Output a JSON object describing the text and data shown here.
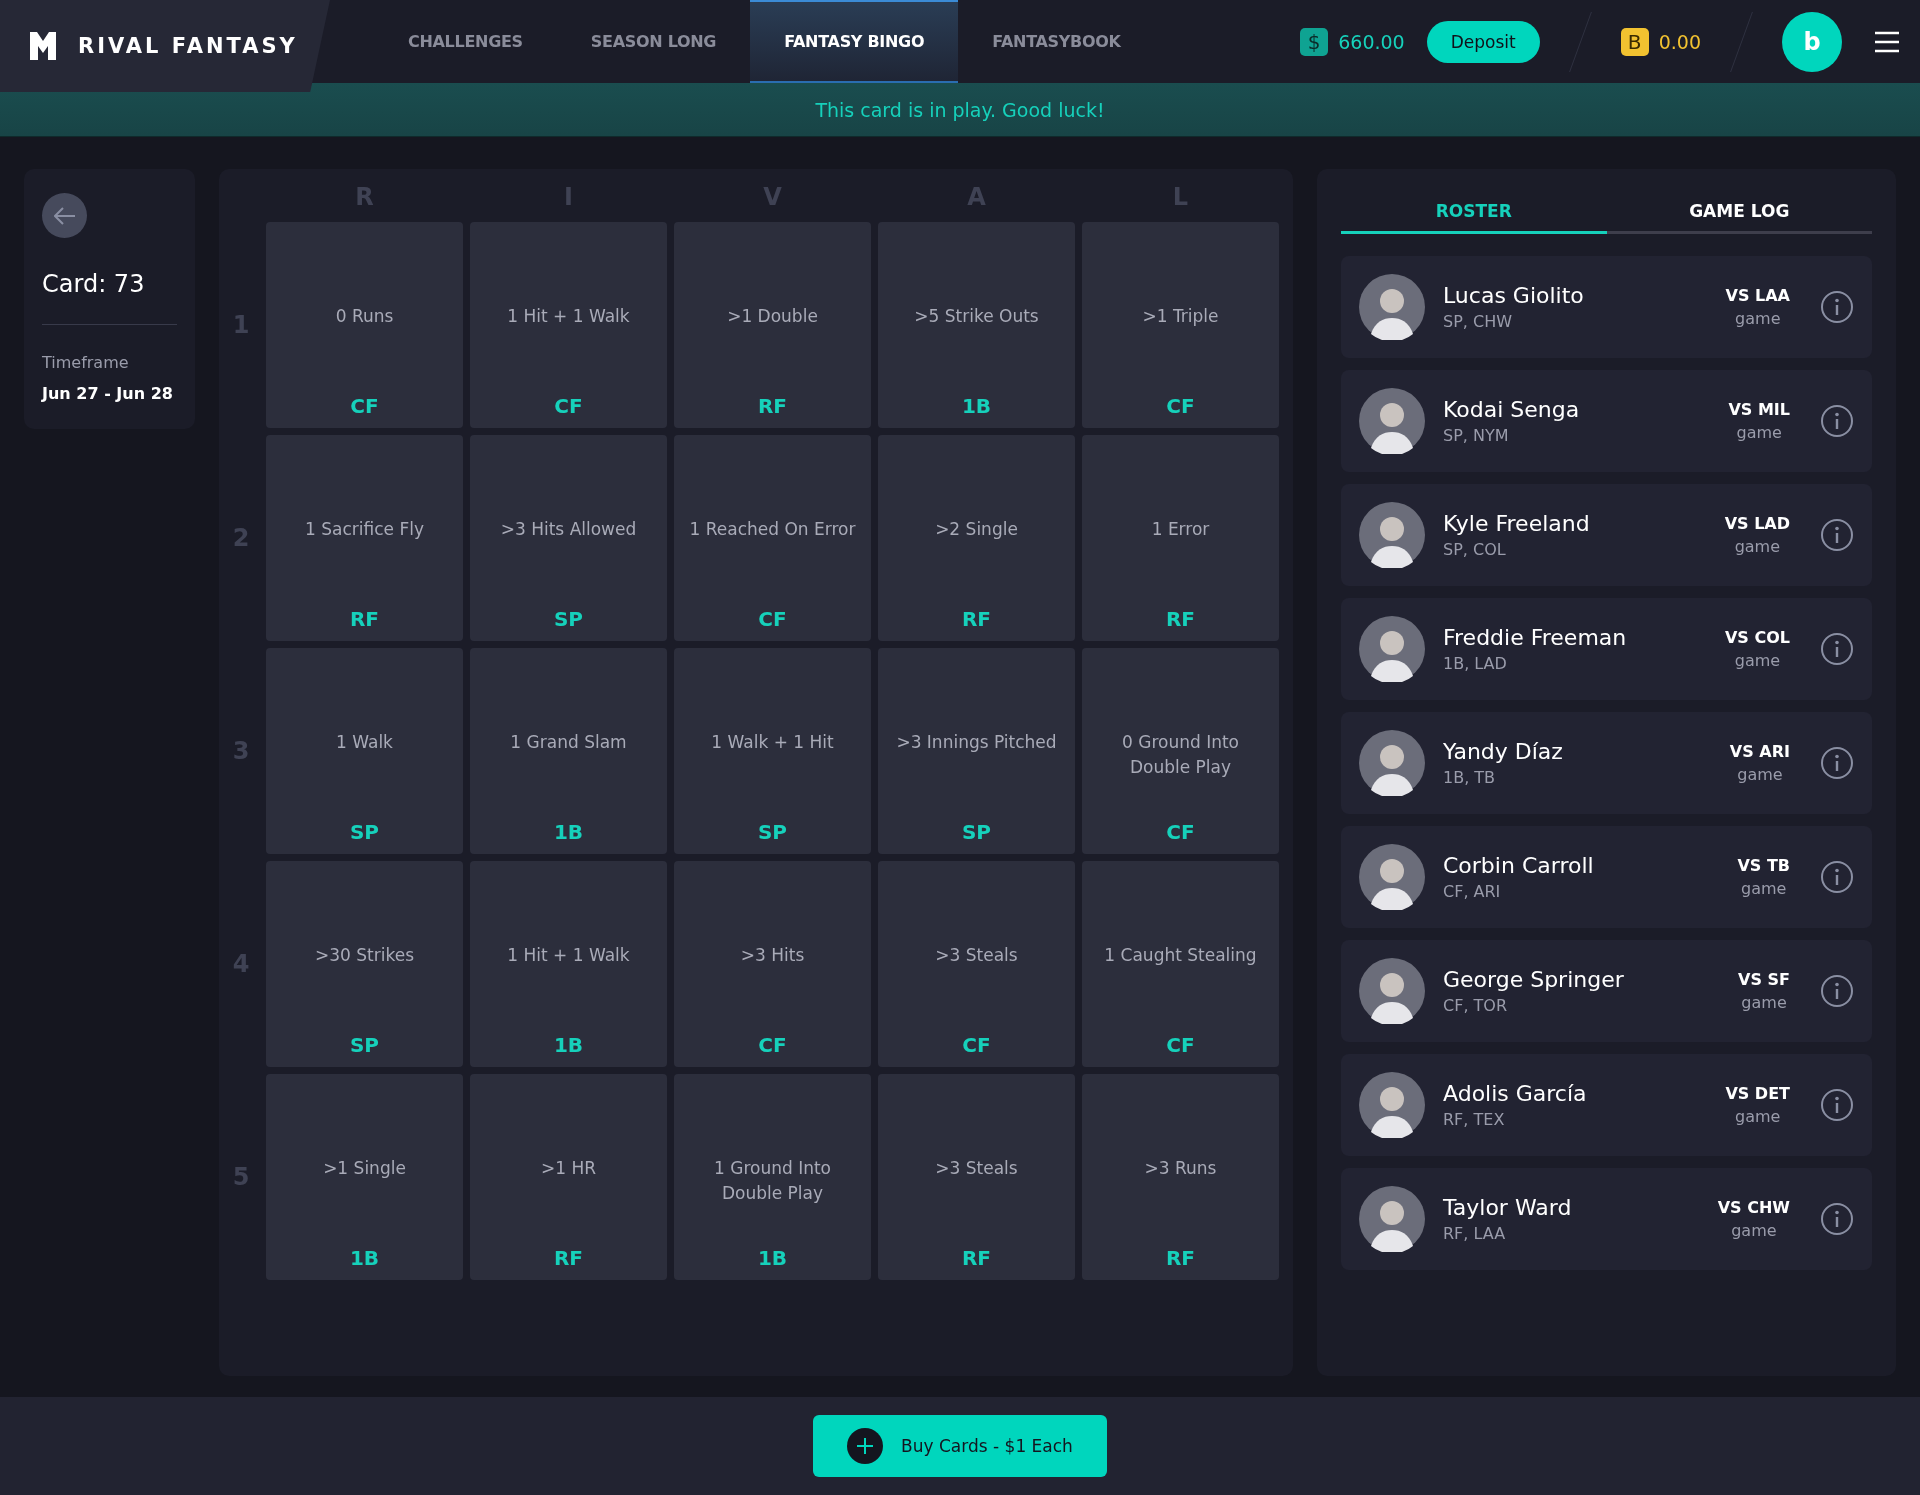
{
  "header": {
    "brand": "RIVAL FANTASY",
    "nav": [
      {
        "label": "CHALLENGES",
        "selected": false
      },
      {
        "label": "SEASON LONG",
        "selected": false
      },
      {
        "label": "FANTASY BINGO",
        "selected": true
      },
      {
        "label": "FANTASYBOOK",
        "selected": false
      }
    ],
    "cash_symbol": "$",
    "cash": "660.00",
    "deposit": "Deposit",
    "bonus_symbol": "B",
    "bonus": "0.00",
    "avatar_letter": "b"
  },
  "banner": "This card is in play. Good luck!",
  "card": {
    "title": "Card: 73",
    "timeframe_label": "Timeframe",
    "timeframe": "Jun 27 - Jun 28"
  },
  "board": {
    "columns": [
      "R",
      "I",
      "V",
      "A",
      "L"
    ],
    "rows": [
      {
        "number": "1",
        "cells": [
          {
            "text": "0 Runs",
            "position": "CF"
          },
          {
            "text": "1 Hit + 1 Walk",
            "position": "CF"
          },
          {
            "text": ">1 Double",
            "position": "RF"
          },
          {
            "text": ">5 Strike Outs",
            "position": "1B"
          },
          {
            "text": ">1 Triple",
            "position": "CF"
          }
        ]
      },
      {
        "number": "2",
        "cells": [
          {
            "text": "1 Sacrifice Fly",
            "position": "RF"
          },
          {
            "text": ">3 Hits Allowed",
            "position": "SP"
          },
          {
            "text": "1 Reached On Error",
            "position": "CF"
          },
          {
            "text": ">2 Single",
            "position": "RF"
          },
          {
            "text": "1 Error",
            "position": "RF"
          }
        ]
      },
      {
        "number": "3",
        "cells": [
          {
            "text": "1 Walk",
            "position": "SP"
          },
          {
            "text": "1 Grand Slam",
            "position": "1B"
          },
          {
            "text": "1 Walk + 1 Hit",
            "position": "SP"
          },
          {
            "text": ">3 Innings Pitched",
            "position": "SP"
          },
          {
            "text": "0 Ground Into Double Play",
            "position": "CF"
          }
        ]
      },
      {
        "number": "4",
        "cells": [
          {
            "text": ">30 Strikes",
            "position": "SP"
          },
          {
            "text": "1 Hit + 1 Walk",
            "position": "1B"
          },
          {
            "text": ">3 Hits",
            "position": "CF"
          },
          {
            "text": ">3 Steals",
            "position": "CF"
          },
          {
            "text": "1 Caught Stealing",
            "position": "CF"
          }
        ]
      },
      {
        "number": "5",
        "cells": [
          {
            "text": ">1 Single",
            "position": "1B"
          },
          {
            "text": ">1 HR",
            "position": "RF"
          },
          {
            "text": "1 Ground Into Double Play",
            "position": "1B"
          },
          {
            "text": ">3 Steals",
            "position": "RF"
          },
          {
            "text": ">3 Runs",
            "position": "RF"
          }
        ]
      }
    ]
  },
  "panel": {
    "tabs": [
      {
        "label": "ROSTER",
        "selected": true
      },
      {
        "label": "GAME LOG",
        "selected": false
      }
    ],
    "players": [
      {
        "name": "Lucas Giolito",
        "position": "SP, CHW",
        "opponent": "VS LAA",
        "status": "game"
      },
      {
        "name": "Kodai Senga",
        "position": "SP, NYM",
        "opponent": "VS MIL",
        "status": "game"
      },
      {
        "name": "Kyle Freeland",
        "position": "SP, COL",
        "opponent": "VS LAD",
        "status": "game"
      },
      {
        "name": "Freddie Freeman",
        "position": "1B, LAD",
        "opponent": "VS COL",
        "status": "game"
      },
      {
        "name": "Yandy Díaz",
        "position": "1B, TB",
        "opponent": "VS ARI",
        "status": "game"
      },
      {
        "name": "Corbin Carroll",
        "position": "CF, ARI",
        "opponent": "VS TB",
        "status": "game"
      },
      {
        "name": "George Springer",
        "position": "CF, TOR",
        "opponent": "VS SF",
        "status": "game"
      },
      {
        "name": "Adolis García",
        "position": "RF, TEX",
        "opponent": "VS DET",
        "status": "game"
      },
      {
        "name": "Taylor Ward",
        "position": "RF, LAA",
        "opponent": "VS CHW",
        "status": "game"
      }
    ]
  },
  "footer": {
    "button": "Buy Cards - $1 Each"
  }
}
